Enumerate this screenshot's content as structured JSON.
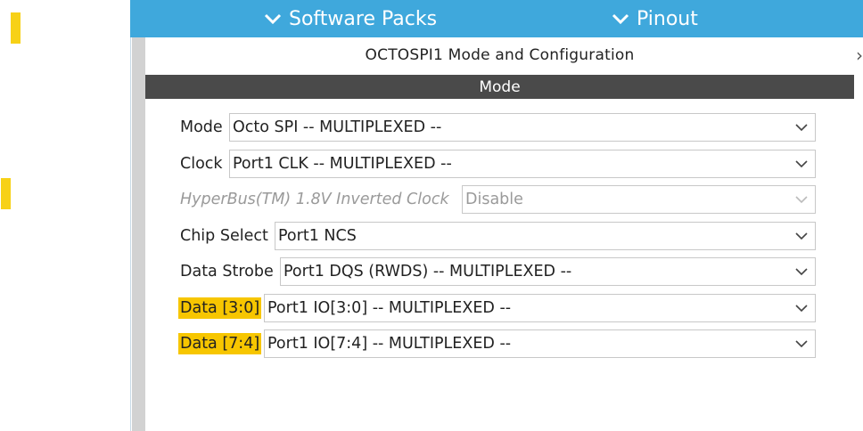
{
  "top_tabs": {
    "software_packs": "Software Packs",
    "pinout": "Pinout"
  },
  "config": {
    "title": "OCTOSPI1 Mode and Configuration",
    "section": "Mode"
  },
  "rows": [
    {
      "label": "Mode",
      "value": "Octo SPI -- MULTIPLEXED --",
      "disabled": false,
      "highlight": false
    },
    {
      "label": "Clock",
      "value": "Port1 CLK -- MULTIPLEXED --",
      "disabled": false,
      "highlight": false
    },
    {
      "label": "HyperBus(TM) 1.8V Inverted Clock",
      "value": "Disable",
      "disabled": true,
      "highlight": false
    },
    {
      "label": "Chip Select",
      "value": "Port1 NCS",
      "disabled": false,
      "highlight": false
    },
    {
      "label": "Data Strobe",
      "value": "Port1 DQS (RWDS) -- MULTIPLEXED --",
      "disabled": false,
      "highlight": false
    },
    {
      "label": "Data [3:0]",
      "value": "Port1 IO[3:0] -- MULTIPLEXED --",
      "disabled": false,
      "highlight": true
    },
    {
      "label": "Data [7:4]",
      "value": "Port1 IO[7:4] -- MULTIPLEXED --",
      "disabled": false,
      "highlight": true
    }
  ],
  "colors": {
    "topbar": "#3fa8dc",
    "section_bar": "#4a4a4a",
    "highlight": "#f7c600"
  }
}
